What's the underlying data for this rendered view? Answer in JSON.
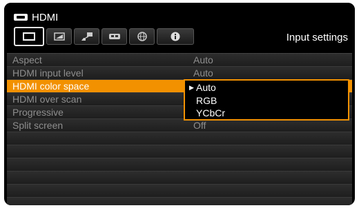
{
  "header": {
    "source_title": "HDMI",
    "source_icon": "hdmi-port-icon",
    "category_label": "Input settings"
  },
  "tabs": [
    {
      "icon": "display-icon",
      "active": true
    },
    {
      "icon": "picture-adjust-icon",
      "active": false
    },
    {
      "icon": "installation-icon",
      "active": false
    },
    {
      "icon": "system-icon",
      "active": false
    },
    {
      "icon": "network-icon",
      "active": false
    },
    {
      "icon": "information-icon",
      "active": false
    }
  ],
  "menu": {
    "rows": [
      {
        "label": "Aspect",
        "value": "Auto"
      },
      {
        "label": "HDMI input level",
        "value": "Auto"
      },
      {
        "label": "HDMI color space",
        "value": ""
      },
      {
        "label": "HDMI over scan",
        "value": ""
      },
      {
        "label": "Progressive",
        "value": ""
      },
      {
        "label": "Split screen",
        "value": "Off"
      }
    ],
    "selected_index": 2
  },
  "dropdown": {
    "options": [
      "Auto",
      "RGB",
      "YCbCr"
    ],
    "current": "Auto",
    "marker": "▶"
  },
  "colors": {
    "accent": "#f29100",
    "background": "#000000",
    "text_active": "#ffffff",
    "text_inactive": "#8e8e8e"
  }
}
